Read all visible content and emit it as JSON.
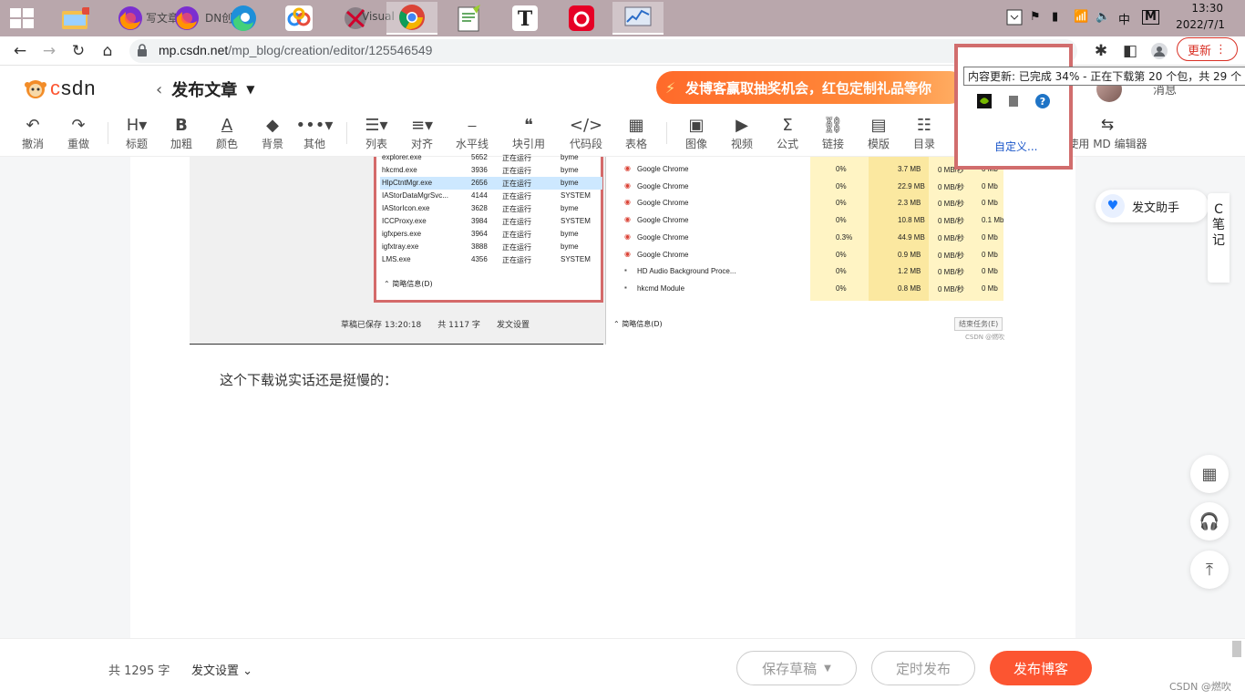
{
  "taskbar": {
    "apps": [
      {
        "name": "file-explorer",
        "label": ""
      },
      {
        "name": "firefox-1",
        "label": "写文章"
      },
      {
        "name": "firefox-2",
        "label": "DN创"
      },
      {
        "name": "edge",
        "label": ""
      },
      {
        "name": "baidu-netdisk",
        "label": ""
      },
      {
        "name": "visual-studio",
        "label": "Visual"
      },
      {
        "name": "chrome",
        "label": ""
      },
      {
        "name": "notepad-plus",
        "label": ""
      },
      {
        "name": "typora",
        "label": ""
      },
      {
        "name": "netease-music",
        "label": ""
      },
      {
        "name": "resource-monitor",
        "label": ""
      }
    ],
    "tray": {
      "ime": "中",
      "ime_mode": "M",
      "time": "13:30",
      "date": "2022/7/1"
    }
  },
  "browser": {
    "url_host": "mp.csdn.net",
    "url_path": "/mp_blog/creation/editor/125546549",
    "update_label": "更新"
  },
  "header": {
    "logo_text": "CSDN",
    "page_title": "发布文章",
    "banner_text": "发博客赢取抽奖机会，红包定制礼品等你",
    "message_label": "消息"
  },
  "toolbar": {
    "tools": [
      {
        "name": "undo",
        "icon": "↶",
        "label": "撤消"
      },
      {
        "name": "redo",
        "icon": "↷",
        "label": "重做"
      },
      {
        "name": "heading",
        "icon": "H▾",
        "label": "标题"
      },
      {
        "name": "bold",
        "icon": "B",
        "label": "加粗"
      },
      {
        "name": "color",
        "icon": "A",
        "label": "颜色"
      },
      {
        "name": "background",
        "icon": "◆",
        "label": "背景"
      },
      {
        "name": "other",
        "icon": "•••▾",
        "label": "其他"
      },
      {
        "name": "list",
        "icon": "☰▾",
        "label": "列表"
      },
      {
        "name": "align",
        "icon": "≡▾",
        "label": "对齐"
      },
      {
        "name": "hr",
        "icon": "⎯",
        "label": "水平线"
      },
      {
        "name": "blockquote",
        "icon": "❝",
        "label": "块引用"
      },
      {
        "name": "code",
        "icon": "</>",
        "label": "代码段"
      },
      {
        "name": "table",
        "icon": "▦",
        "label": "表格"
      },
      {
        "name": "image",
        "icon": "▣",
        "label": "图像"
      },
      {
        "name": "video",
        "icon": "▶",
        "label": "视频"
      },
      {
        "name": "formula",
        "icon": "Σ",
        "label": "公式"
      },
      {
        "name": "link",
        "icon": "⛓",
        "label": "链接"
      },
      {
        "name": "template",
        "icon": "▤",
        "label": "模版"
      },
      {
        "name": "toc",
        "icon": "☷",
        "label": "目录"
      }
    ],
    "md_label": "使用 MD 编辑器"
  },
  "embedded_screenshot": {
    "processes": [
      {
        "name": "explorer.exe",
        "pid": "5652",
        "status": "正在运行",
        "user": "byme"
      },
      {
        "name": "hkcmd.exe",
        "pid": "3936",
        "status": "正在运行",
        "user": "byme"
      },
      {
        "name": "HlpCtntMgr.exe",
        "pid": "2656",
        "status": "正在运行",
        "user": "byme"
      },
      {
        "name": "IAStorDataMgrSvc...",
        "pid": "4144",
        "status": "正在运行",
        "user": "SYSTEM"
      },
      {
        "name": "IAStorIcon.exe",
        "pid": "3628",
        "status": "正在运行",
        "user": "byme"
      },
      {
        "name": "ICCProxy.exe",
        "pid": "3984",
        "status": "正在运行",
        "user": "SYSTEM"
      },
      {
        "name": "igfxpers.exe",
        "pid": "3964",
        "status": "正在运行",
        "user": "byme"
      },
      {
        "name": "igfxtray.exe",
        "pid": "3888",
        "status": "正在运行",
        "user": "byme"
      },
      {
        "name": "LMS.exe",
        "pid": "4356",
        "status": "正在运行",
        "user": "SYSTEM"
      }
    ],
    "left_footer": "简略信息(D)",
    "task_rows": [
      {
        "name": "Google Chrome",
        "cpu": "0%",
        "mem": "3.7 MB",
        "disk": "0 MB/秒",
        "net": "0 Mb"
      },
      {
        "name": "Google Chrome",
        "cpu": "0%",
        "mem": "22.9 MB",
        "disk": "0 MB/秒",
        "net": "0 Mb"
      },
      {
        "name": "Google Chrome",
        "cpu": "0%",
        "mem": "2.3 MB",
        "disk": "0 MB/秒",
        "net": "0 Mb"
      },
      {
        "name": "Google Chrome",
        "cpu": "0%",
        "mem": "10.8 MB",
        "disk": "0 MB/秒",
        "net": "0.1 Mb"
      },
      {
        "name": "Google Chrome",
        "cpu": "0.3%",
        "mem": "44.9 MB",
        "disk": "0 MB/秒",
        "net": "0 Mb"
      },
      {
        "name": "Google Chrome",
        "cpu": "0%",
        "mem": "0.9 MB",
        "disk": "0 MB/秒",
        "net": "0 Mb"
      },
      {
        "name": "HD Audio Background Proce...",
        "cpu": "0%",
        "mem": "1.2 MB",
        "disk": "0 MB/秒",
        "net": "0 Mb"
      },
      {
        "name": "hkcmd Module",
        "cpu": "0%",
        "mem": "0.8 MB",
        "disk": "0 MB/秒",
        "net": "0 Mb"
      }
    ],
    "right_footer": "简略信息(D)",
    "end_task": "结束任务(E)",
    "watermark": "CSDN @燃吹",
    "status_saved": "草稿已保存 13:20:18",
    "status_count": "共 1117 字",
    "status_settings": "发文设置"
  },
  "body_text": "这个下载说实话还是挺慢的：",
  "side": {
    "assistant_label": "发文助手",
    "note_tab": [
      "C",
      "笔",
      "记"
    ]
  },
  "footer": {
    "word_count": "共 1295 字",
    "post_settings": "发文设置",
    "save_draft": "保存草稿",
    "scheduled": "定时发布",
    "publish": "发布博客",
    "watermark": "CSDN @燃吹"
  },
  "tray_popup": {
    "tooltip": "内容更新: 已完成 34% - 正在下载第 20 个包，共 29 个",
    "customize": "自定义..."
  },
  "colors": {
    "accent": "#fc5531",
    "taskbar": "#b9a7ac",
    "highlight_border": "#d16d6d"
  }
}
